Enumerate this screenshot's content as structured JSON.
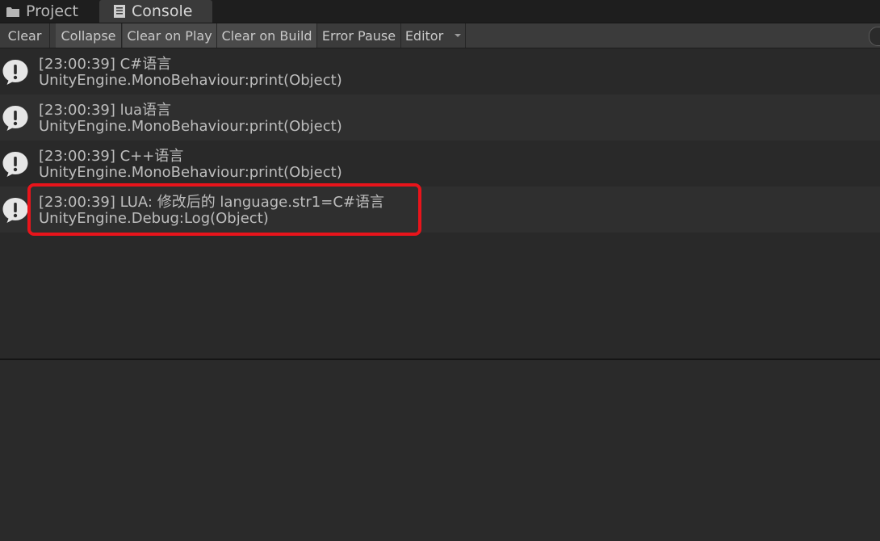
{
  "tabs": [
    {
      "label": "Project",
      "icon": "folder-icon",
      "active": false
    },
    {
      "label": "Console",
      "icon": "console-icon",
      "active": true
    }
  ],
  "toolbar": {
    "clear": "Clear",
    "collapse": "Collapse",
    "clear_on_play": "Clear on Play",
    "clear_on_build": "Clear on Build",
    "error_pause": "Error Pause",
    "editor": "Editor"
  },
  "logs": [
    {
      "message": "[23:00:39] C#语言",
      "trace": "UnityEngine.MonoBehaviour:print(Object)",
      "icon": "info-bubble-icon"
    },
    {
      "message": "[23:00:39] lua语言",
      "trace": "UnityEngine.MonoBehaviour:print(Object)",
      "icon": "info-bubble-icon"
    },
    {
      "message": "[23:00:39] C++语言",
      "trace": "UnityEngine.MonoBehaviour:print(Object)",
      "icon": "info-bubble-icon"
    },
    {
      "message": "[23:00:39] LUA: 修改后的 language.str1=C#语言",
      "trace": "UnityEngine.Debug:Log(Object)",
      "icon": "info-bubble-icon"
    }
  ],
  "colors": {
    "highlight": "#e8141b",
    "background": "#292929",
    "toolbar": "#3b3b3b"
  }
}
